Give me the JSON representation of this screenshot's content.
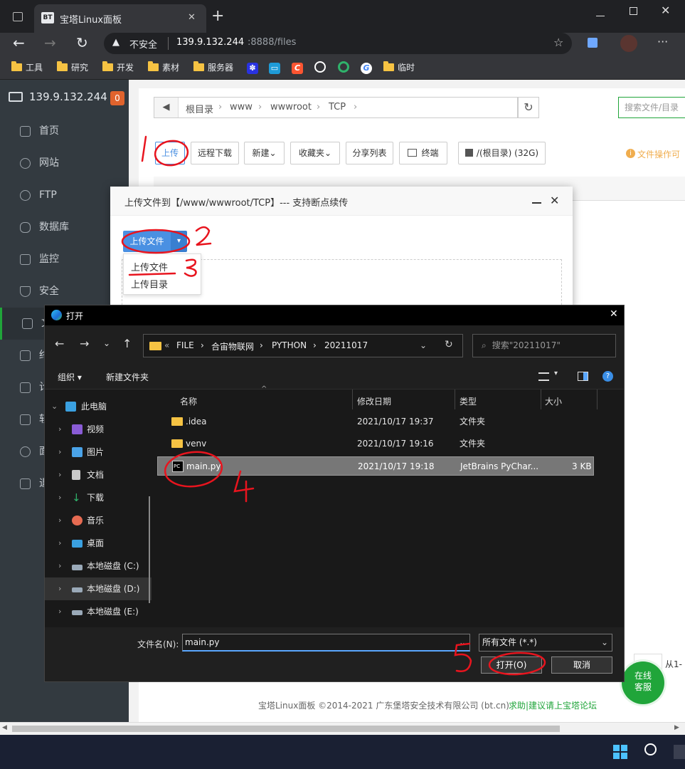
{
  "browser": {
    "tab_badge": "BT",
    "tab_title": "宝塔Linux面板",
    "tab_close": "✕",
    "new_tab": "+",
    "security_label": "不安全",
    "url_host": "139.9.132.244",
    "url_rest": ":8888/files",
    "bookmarks": [
      "工具",
      "研究",
      "开发",
      "素材",
      "服务器",
      "临时"
    ]
  },
  "panel": {
    "server_ip": "139.9.132.244",
    "notice_count": "0",
    "menu": [
      "首页",
      "网站",
      "FTP",
      "数据库",
      "监控",
      "安全",
      "文",
      "终",
      "计",
      "软",
      "面",
      "退"
    ],
    "breadcrumb": [
      "根目录",
      "www",
      "wwwroot",
      "TCP"
    ],
    "search_placeholder": "搜索文件/目录",
    "toolbar": {
      "upload": "上传",
      "remote_download": "远程下载",
      "new": "新建",
      "favorites": "收藏夹",
      "share_list": "分享列表",
      "terminal": "终端",
      "disk": "/(根目录) (32G)",
      "file_ops_tip": "文件操作可"
    },
    "footer_text": "宝塔Linux面板 ©2014-2021 广东堡塔安全技术有限公司 (bt.cn)",
    "footer_link": "求助|建议请上宝塔论坛",
    "online_service": [
      "在线",
      "客服"
    ],
    "pager_fragment": "从1-"
  },
  "upload_modal": {
    "title": "上传文件到【/www/wwwroot/TCP】--- 支持断点续传",
    "upload_file_btn": "上传文件",
    "dropdown": [
      "上传文件",
      "上传目录"
    ]
  },
  "file_dialog": {
    "title": "打开",
    "path": [
      "«",
      "FILE",
      "合宙物联网",
      "PYTHON",
      "20211017"
    ],
    "search_placeholder": "搜索\"20211017\"",
    "organize": "组织",
    "new_folder": "新建文件夹",
    "columns": [
      "名称",
      "修改日期",
      "类型",
      "大小"
    ],
    "tree": [
      {
        "label": "此电脑",
        "icon": "pc-icon",
        "color": "#3aa0e0"
      },
      {
        "label": "视频",
        "icon": "video-icon",
        "color": "#8a5cd6"
      },
      {
        "label": "图片",
        "icon": "picture-icon",
        "color": "#4aa3e8"
      },
      {
        "label": "文档",
        "icon": "document-icon",
        "color": "#c9c9c9"
      },
      {
        "label": "下载",
        "icon": "download-icon",
        "color": "#2fb36b"
      },
      {
        "label": "音乐",
        "icon": "music-icon",
        "color": "#e66b52"
      },
      {
        "label": "桌面",
        "icon": "desktop-icon",
        "color": "#3aa0e0"
      },
      {
        "label": "本地磁盘 (C:)",
        "icon": "drive-c-icon",
        "color": "#9aa9b8"
      },
      {
        "label": "本地磁盘 (D:)",
        "icon": "drive-d-icon",
        "color": "#9aa9b8"
      },
      {
        "label": "本地磁盘 (E:)",
        "icon": "drive-e-icon",
        "color": "#9aa9b8"
      }
    ],
    "files": [
      {
        "name": ".idea",
        "date": "2021/10/17 19:37",
        "type": "文件夹",
        "size": "",
        "icon": "folder-icon"
      },
      {
        "name": "venv",
        "date": "2021/10/17 19:16",
        "type": "文件夹",
        "size": "",
        "icon": "folder-icon"
      },
      {
        "name": "main.py",
        "date": "2021/10/17 19:18",
        "type": "JetBrains PyChar...",
        "size": "3 KB",
        "icon": "pycharm-icon"
      }
    ],
    "filename_label": "文件名(N):",
    "filename_value": "main.py",
    "filetype": "所有文件 (*.*)",
    "open_btn": "打开(O)",
    "cancel_btn": "取消"
  },
  "colors": {
    "accent_blue": "#4a90e2",
    "bt_green": "#20a53a",
    "annotation_red": "#e8141e"
  }
}
